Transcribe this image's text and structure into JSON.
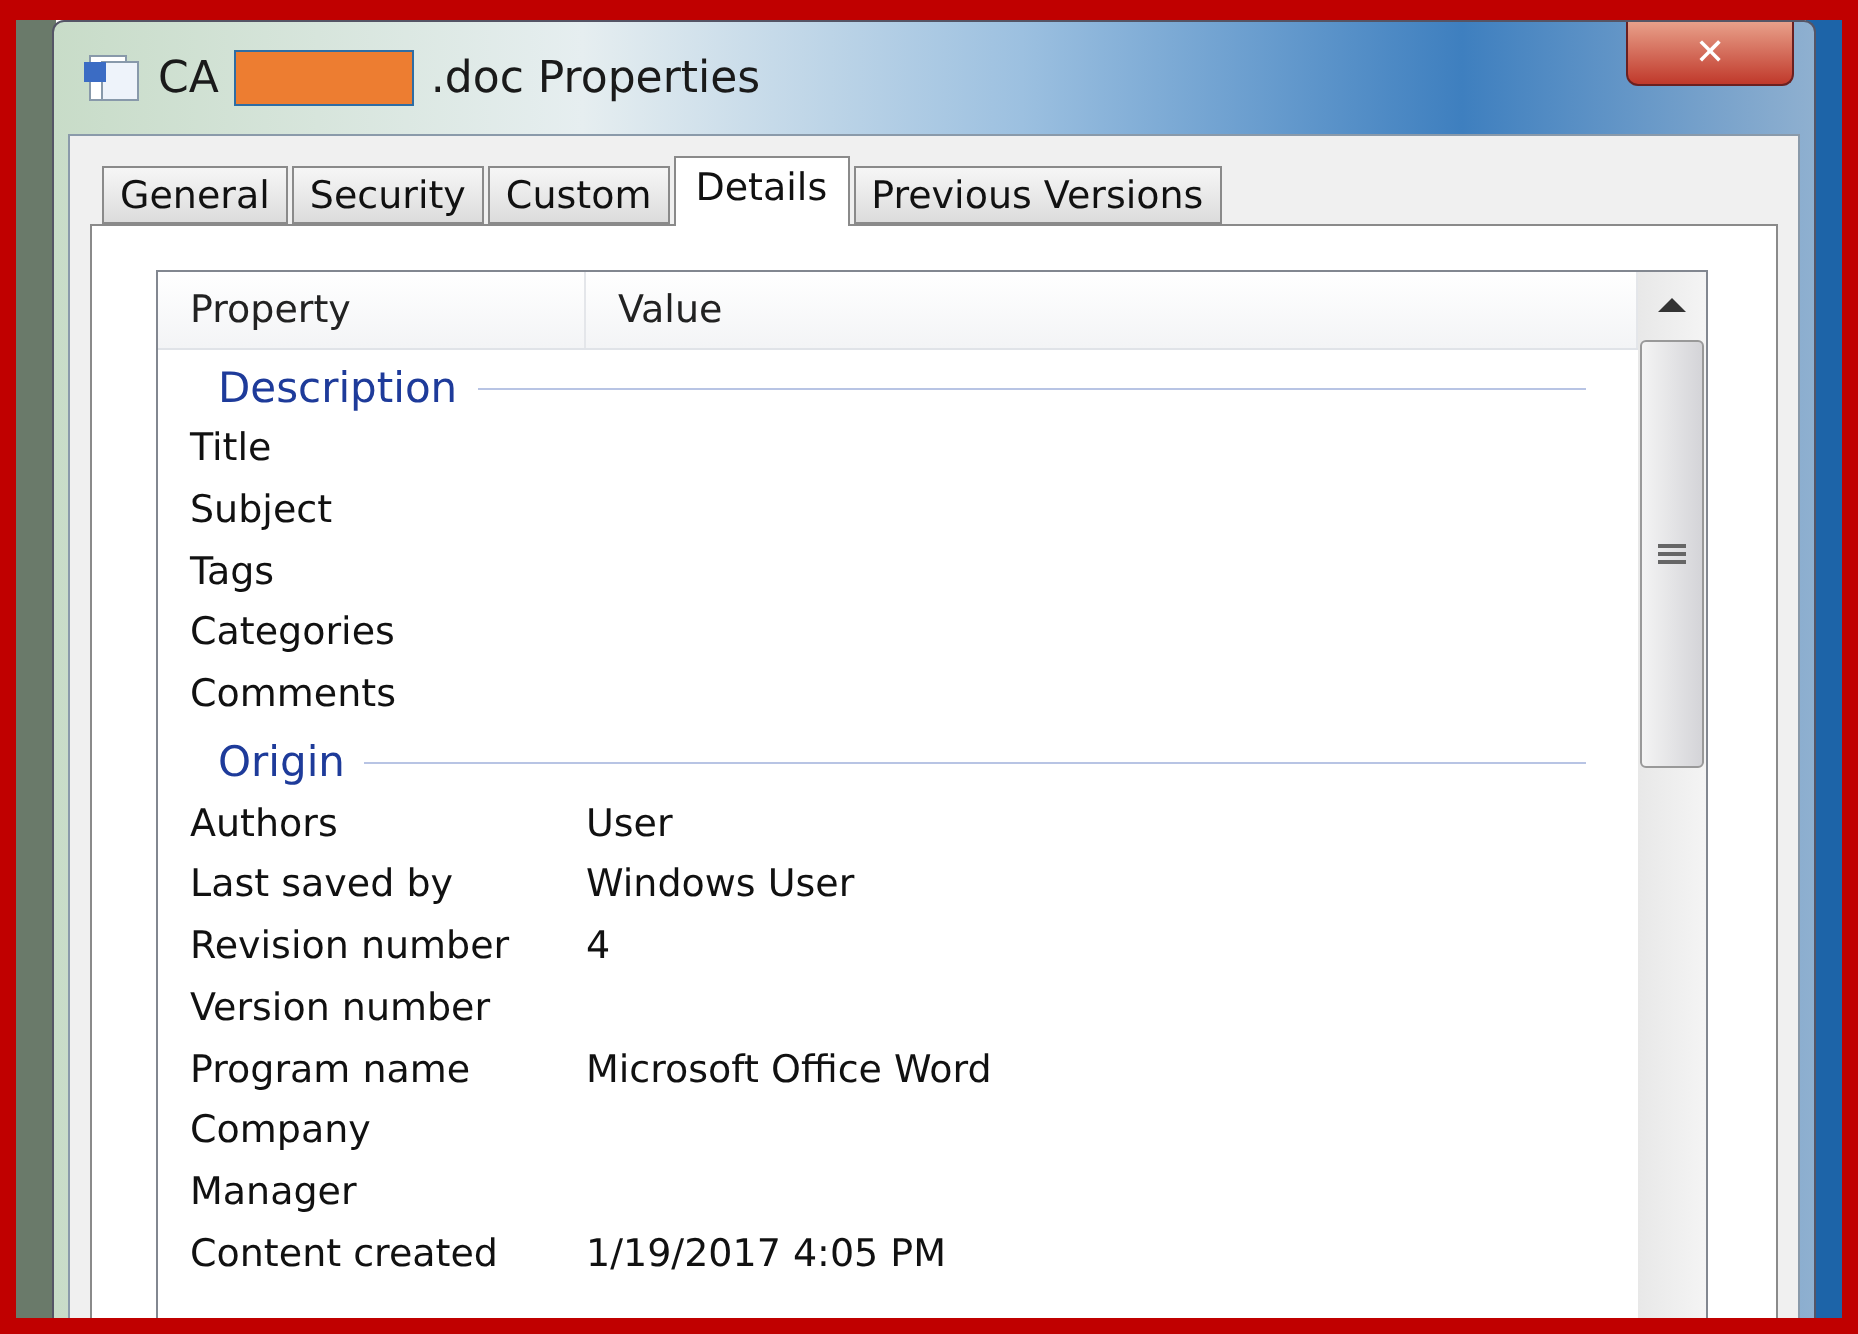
{
  "window": {
    "title_start": "CA",
    "title_end": ".doc Properties",
    "close_label": "✕"
  },
  "tabs": [
    {
      "label": "General",
      "selected": false
    },
    {
      "label": "Security",
      "selected": false
    },
    {
      "label": "Custom",
      "selected": false
    },
    {
      "label": "Details",
      "selected": true
    },
    {
      "label": "Previous Versions",
      "selected": false
    }
  ],
  "list": {
    "columns": [
      "Property",
      "Value"
    ],
    "groups": [
      {
        "heading": "Description",
        "rows": [
          {
            "property": "Title"
          },
          {
            "property": "Subject"
          },
          {
            "property": "Tags"
          },
          {
            "property": "Categories"
          },
          {
            "property": "Comments"
          }
        ]
      },
      {
        "heading": "Origin",
        "rows": [
          {
            "property": "Authors",
            "value": "User"
          },
          {
            "property": "Last saved by",
            "value": "Windows User"
          },
          {
            "property": "Revision number",
            "value": "4"
          },
          {
            "property": "Version number"
          },
          {
            "property": "Program name",
            "value": "Microsoft Office Word"
          },
          {
            "property": "Company"
          },
          {
            "property": "Manager"
          },
          {
            "property": "Content created",
            "value": "1/19/2017 4:05 PM"
          }
        ]
      }
    ]
  }
}
